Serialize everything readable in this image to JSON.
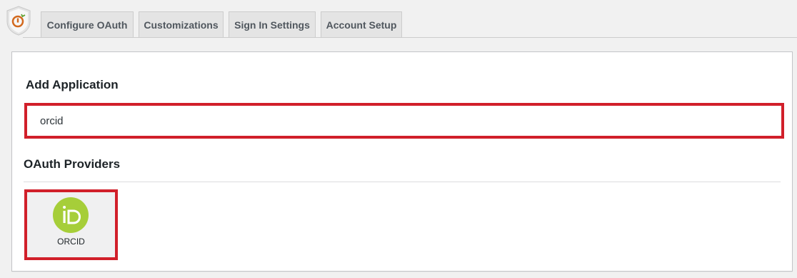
{
  "tabs": [
    {
      "label": "Configure OAuth"
    },
    {
      "label": "Customizations"
    },
    {
      "label": "Sign In Settings"
    },
    {
      "label": "Account Setup"
    }
  ],
  "main": {
    "add_application_title": "Add Application",
    "search": {
      "value": "orcid"
    },
    "providers_title": "OAuth Providers",
    "providers": [
      {
        "label": "ORCID",
        "icon": "orcid-icon",
        "icon_color": "#a6ce39"
      }
    ]
  },
  "colors": {
    "highlight": "#d11f2a",
    "logo_accent": "#d2691e"
  }
}
